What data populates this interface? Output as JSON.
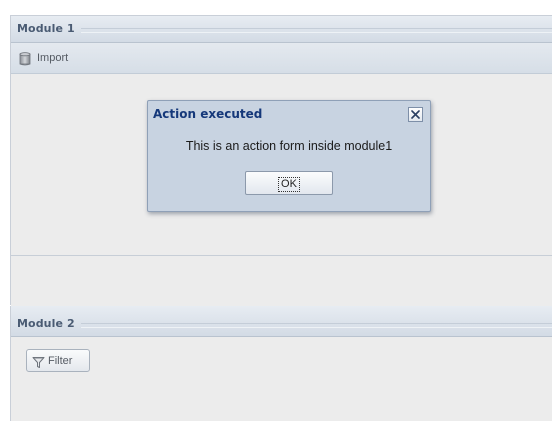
{
  "module1": {
    "title": "Module 1",
    "toolbar": {
      "import_label": "Import",
      "import_icon": "database-icon"
    }
  },
  "dialog": {
    "title": "Action executed",
    "message": "This is an action form inside module1",
    "ok_label": "OK",
    "close_icon": "close-icon"
  },
  "module2": {
    "title": "Module 2",
    "filter_label": "Filter",
    "filter_icon": "funnel-icon"
  },
  "colors": {
    "dialog_title": "#15387a",
    "module_title": "#4a5b73",
    "dialog_background": "#c8d3e1",
    "panel_background": "#ececec"
  }
}
